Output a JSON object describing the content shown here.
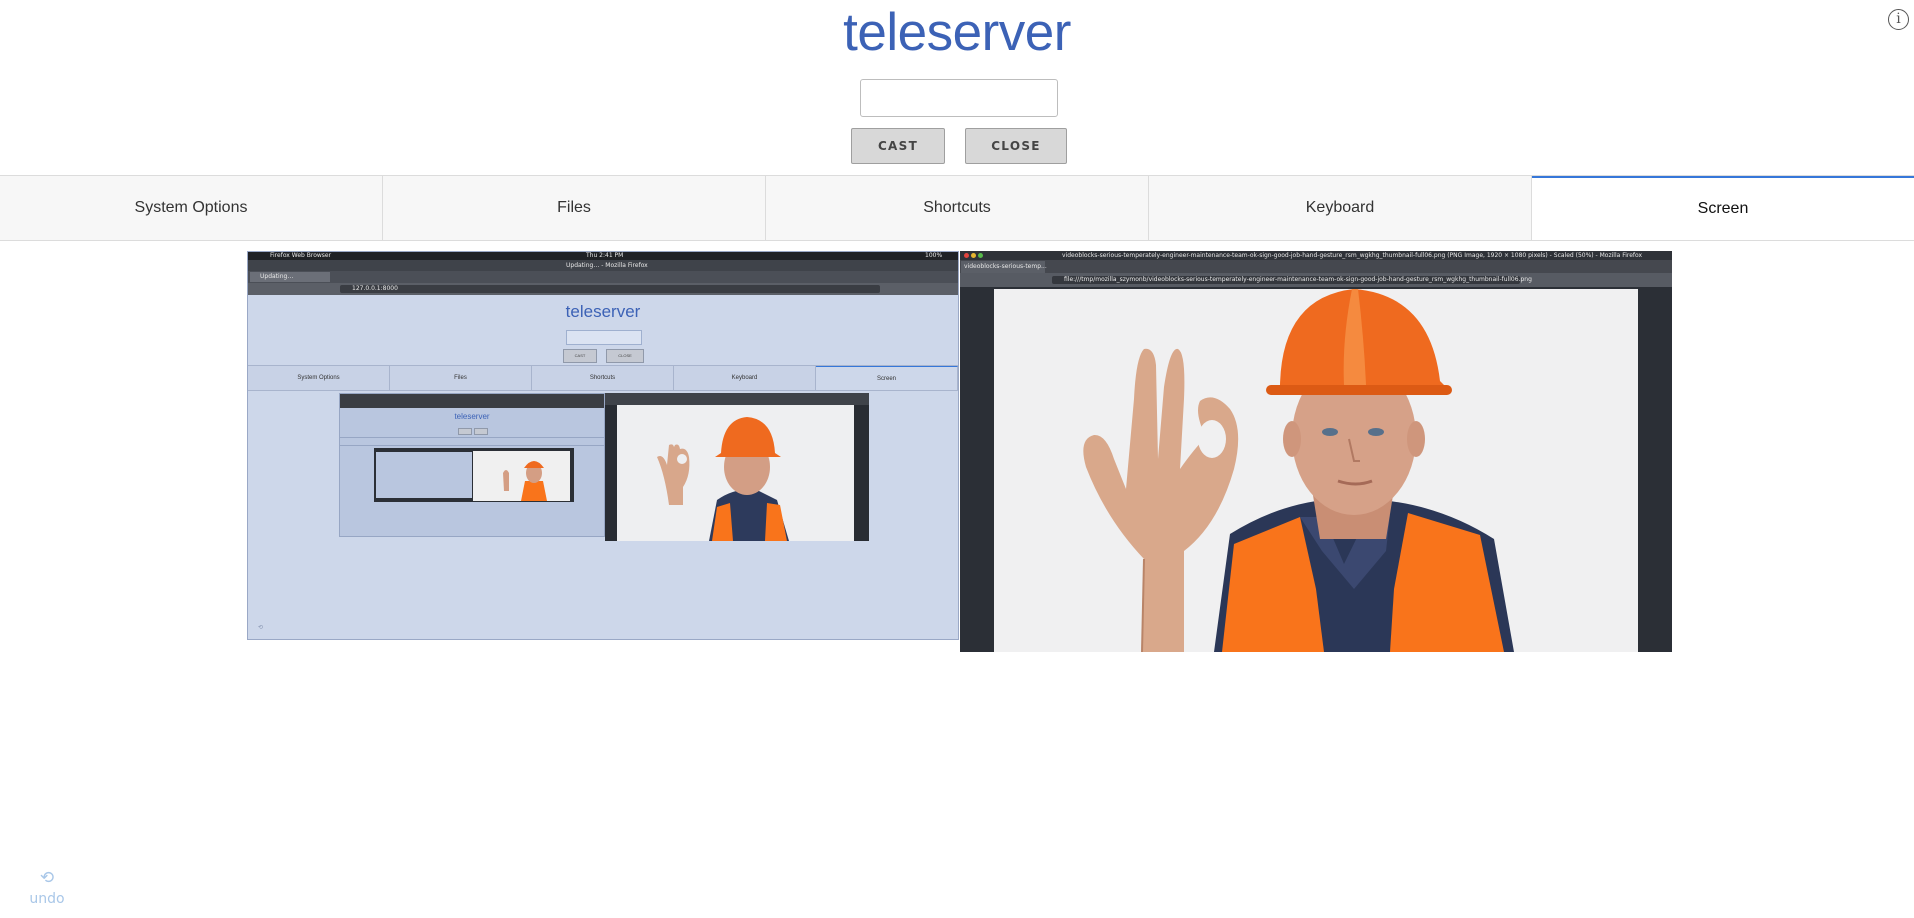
{
  "header": {
    "title": "teleserver",
    "info_icon": "info-icon",
    "cast_input_value": "",
    "cast_label": "CAST",
    "close_label": "CLOSE"
  },
  "tabs": [
    {
      "label": "System Options"
    },
    {
      "label": "Files"
    },
    {
      "label": "Shortcuts"
    },
    {
      "label": "Keyboard"
    },
    {
      "label": "Screen",
      "active": true
    }
  ],
  "screen_left": {
    "panel_app": "Firefox Web Browser",
    "clock": "Thu  2:41 PM",
    "window_title": "Updating… - Mozilla Firefox",
    "tab_label": "Updating…",
    "url": "127.0.0.1:8000",
    "zoom": "100%",
    "page_title": "teleserver",
    "cast_label": "CAST",
    "close_label": "CLOSE",
    "tabs": [
      "System Options",
      "Files",
      "Shortcuts",
      "Keyboard",
      "Screen"
    ]
  },
  "screen_right": {
    "window_title": "videoblocks-serious-temperately-engineer-maintenance-team-ok-sign-good-job-hand-gesture_rsm_wgkhg_thumbnail-full06.png (PNG Image, 1920 × 1080 pixels) - Scaled (50%) - Mozilla Firefox",
    "tab_label": "videoblocks-serious-temp...",
    "url": "file:///tmp/mozilla_szymonb/videoblocks-serious-temperately-engineer-maintenance-team-ok-sign-good-job-hand-gesture_rsm_wgkhg_thumbnail-full06.png"
  },
  "footer": {
    "undo_icon": "undo-icon",
    "undo_label": "undo"
  },
  "colors": {
    "title": "#3c62b6",
    "active_tab_indicator": "#3677d9",
    "hardhat": "#ef6a1f",
    "vest": "#f9741b",
    "undo": "#a9c7e8"
  }
}
